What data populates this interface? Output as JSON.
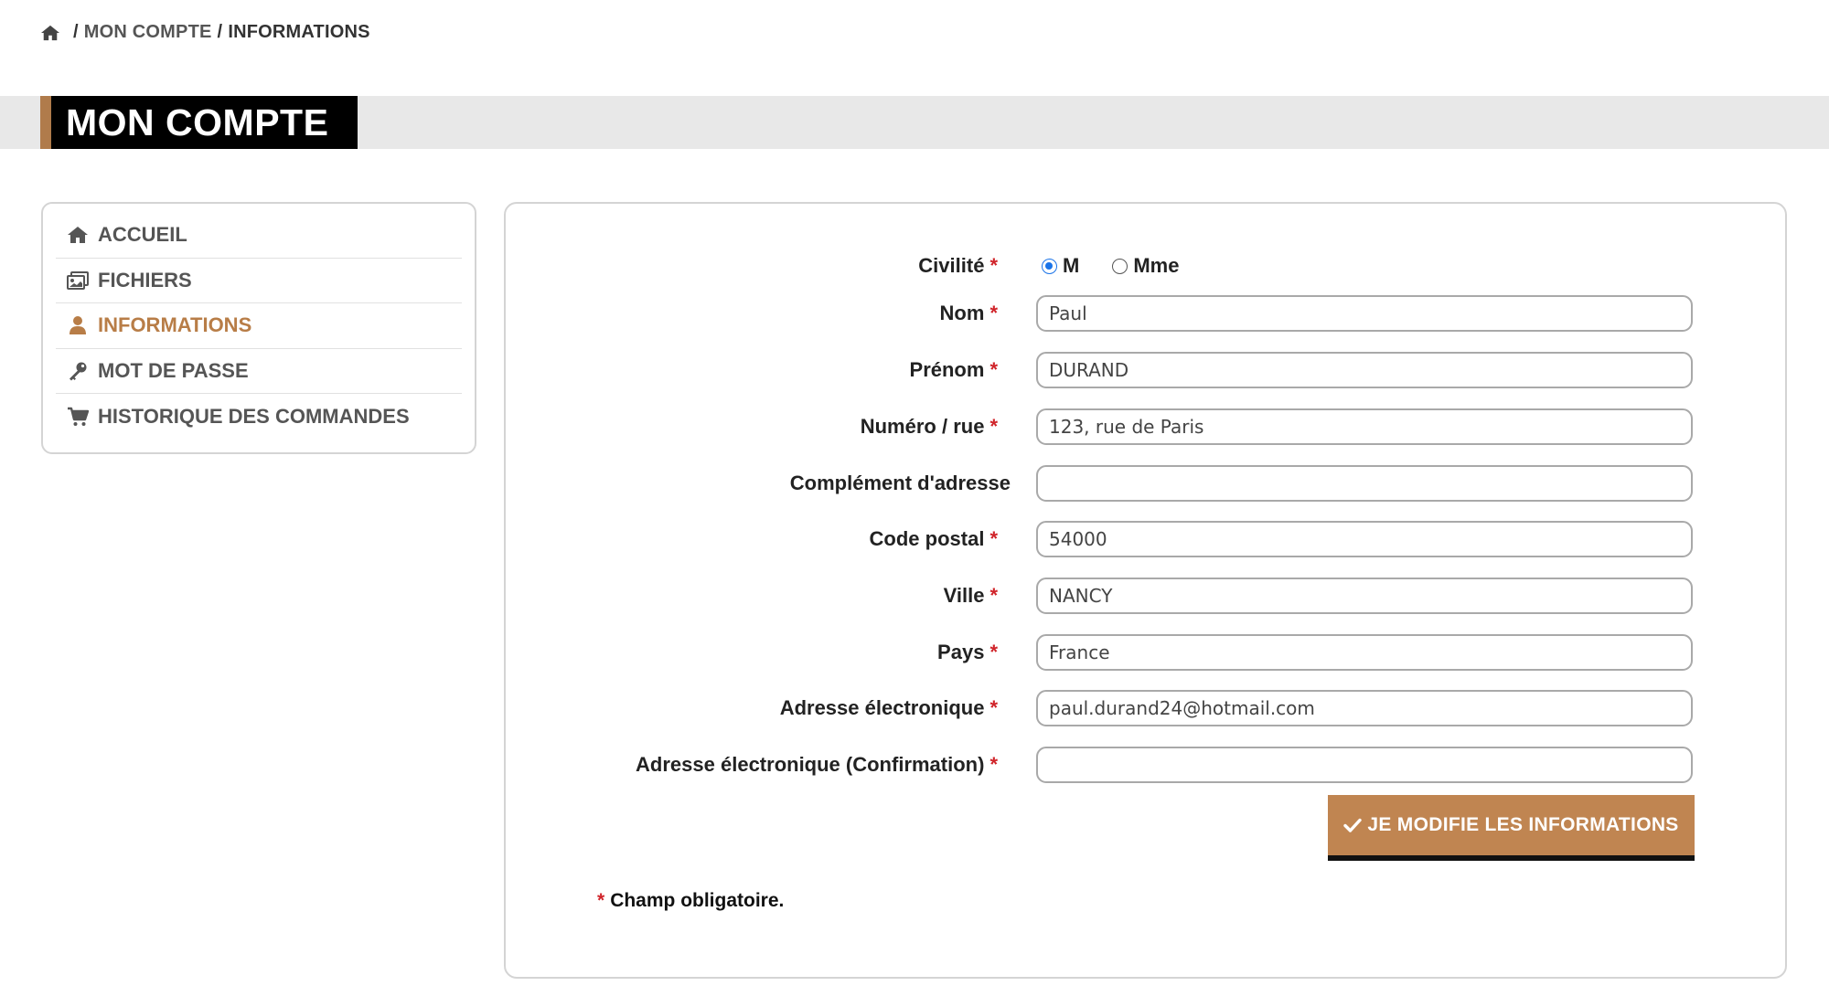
{
  "breadcrumb": {
    "home_icon": "home-icon",
    "separator": "/",
    "items": [
      "MON COMPTE",
      "INFORMATIONS"
    ]
  },
  "page": {
    "title": "MON COMPTE"
  },
  "colors": {
    "accent": "#b87d47",
    "button": "#c08551",
    "required": "#d0242a",
    "title_bg": "#000000",
    "band_bg": "#e8e8e8"
  },
  "sidebar": {
    "items": [
      {
        "label": "ACCUEIL",
        "icon": "home-icon",
        "active": false
      },
      {
        "label": "FICHIERS",
        "icon": "images-icon",
        "active": false
      },
      {
        "label": "INFORMATIONS",
        "icon": "user-icon",
        "active": true
      },
      {
        "label": "MOT DE PASSE",
        "icon": "key-icon",
        "active": false
      },
      {
        "label": "HISTORIQUE DES COMMANDES",
        "icon": "cart-icon",
        "active": false
      }
    ]
  },
  "form": {
    "required_marker": "*",
    "civilite": {
      "label": "Civilité",
      "options": [
        {
          "label": "M",
          "selected": true
        },
        {
          "label": "Mme",
          "selected": false
        }
      ]
    },
    "fields": [
      {
        "label": "Nom",
        "value": "Paul",
        "required": true
      },
      {
        "label": "Prénom",
        "value": "DURAND",
        "required": true
      },
      {
        "label": "Numéro / rue",
        "value": "123, rue de Paris",
        "required": true
      },
      {
        "label": "Complément d'adresse",
        "value": "",
        "required": false
      },
      {
        "label": "Code postal",
        "value": "54000",
        "required": true
      },
      {
        "label": "Ville",
        "value": "NANCY",
        "required": true
      },
      {
        "label": "Pays",
        "value": "France",
        "required": true
      },
      {
        "label": "Adresse électronique",
        "value": "paul.durand24@hotmail.com",
        "required": true
      },
      {
        "label": "Adresse électronique (Confirmation)",
        "value": "",
        "required": true
      }
    ],
    "submit_label": "JE MODIFIE LES INFORMATIONS",
    "required_note": "Champ obligatoire."
  }
}
